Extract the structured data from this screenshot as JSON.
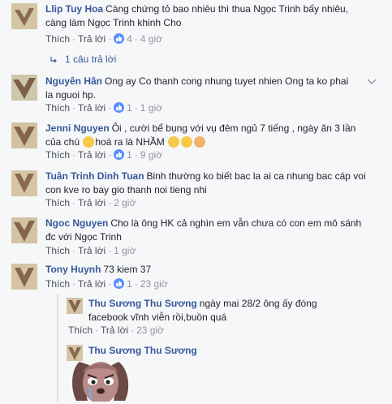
{
  "comments": [
    {
      "name": "Llip Tuy Hoa",
      "text": "Càng chứng tỏ bao nhiêu thì thua Ngọc Trinh bấy nhiêu, càng làm Ngọc Trinh khinh Cho",
      "like_label": "Thích",
      "reply_label": "Trả lời",
      "like_count": "4",
      "time": "4 giờ"
    },
    {
      "name": "Nguyên Hân",
      "text": "Ong ay Co thanh cong nhung tuyet nhien Ong ta ko phai la nguoi hp.",
      "like_label": "Thích",
      "reply_label": "Trả lời",
      "like_count": "1",
      "time": "1 giờ"
    },
    {
      "name": "Jenni Nguyen",
      "text_a": "Ôi , cười bể bụng với vụ đêm ngủ 7 tiếng , ngày ăn 3 lần của chú",
      "text_b": "hoá ra là NHẦM",
      "like_label": "Thích",
      "reply_label": "Trả lời",
      "like_count": "1",
      "time": "9 giờ"
    },
    {
      "name": "Tuân Trinh Dinh Tuan",
      "text": "Binh thường ko biết bac la ai ca nhung bac cáp voi con kve ro bay gio thanh noi tieng nhi",
      "like_label": "Thích",
      "reply_label": "Trả lời",
      "time": "2 giờ"
    },
    {
      "name": "Ngoc Nguyen",
      "text": "Cho là ông HK cả nghìn em vẫn chưa có con em mô sánh đc với Ngọc Trinh",
      "like_label": "Thích",
      "reply_label": "Trả lời",
      "time": "1 giờ"
    },
    {
      "name": "Tony Huynh",
      "text": "73 kiem 37",
      "like_label": "Thích",
      "reply_label": "Trả lời",
      "like_count": "1",
      "time": "23 giờ"
    }
  ],
  "replies_link": "1 câu trả lời",
  "replies": [
    {
      "name": "Thu Sương Thu Sương",
      "text": "ngày mai 28/2 ông ấy đóng facebook vĩnh viễn rồi,buồn quá",
      "like_label": "Thích",
      "reply_label": "Trả lời",
      "time": "23 giờ"
    },
    {
      "name": "Thu Sương Thu Sương"
    }
  ],
  "dot": "·"
}
